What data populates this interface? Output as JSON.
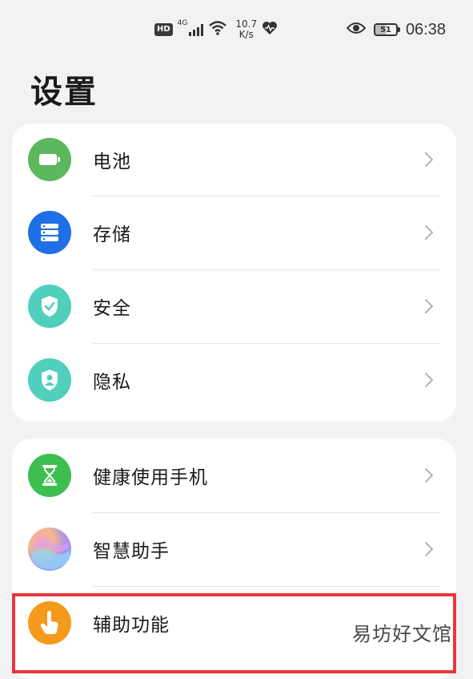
{
  "status_bar": {
    "hd": "HD",
    "network_gen": "4G",
    "speed_value": "10.7",
    "speed_unit": "K/s",
    "battery_level": "51",
    "time": "06:38"
  },
  "page_title": "设置",
  "groups": [
    {
      "items": [
        {
          "label": "电池",
          "icon": "battery-icon",
          "color": "#5bb85d"
        },
        {
          "label": "存储",
          "icon": "storage-icon",
          "color": "#1f6fe6"
        },
        {
          "label": "安全",
          "icon": "security-shield-icon",
          "color": "#4fcfbc"
        },
        {
          "label": "隐私",
          "icon": "privacy-shield-icon",
          "color": "#4fcfbc"
        }
      ]
    },
    {
      "items": [
        {
          "label": "健康使用手机",
          "icon": "hourglass-icon",
          "color": "#3cbf4f"
        },
        {
          "label": "智慧助手",
          "icon": "assistant-icon",
          "color": "#b98fe8"
        },
        {
          "label": "辅助功能",
          "icon": "accessibility-hand-icon",
          "color": "#f59a1b"
        }
      ]
    }
  ],
  "highlight_color": "#e8373b",
  "watermark": "易坊好文馆"
}
